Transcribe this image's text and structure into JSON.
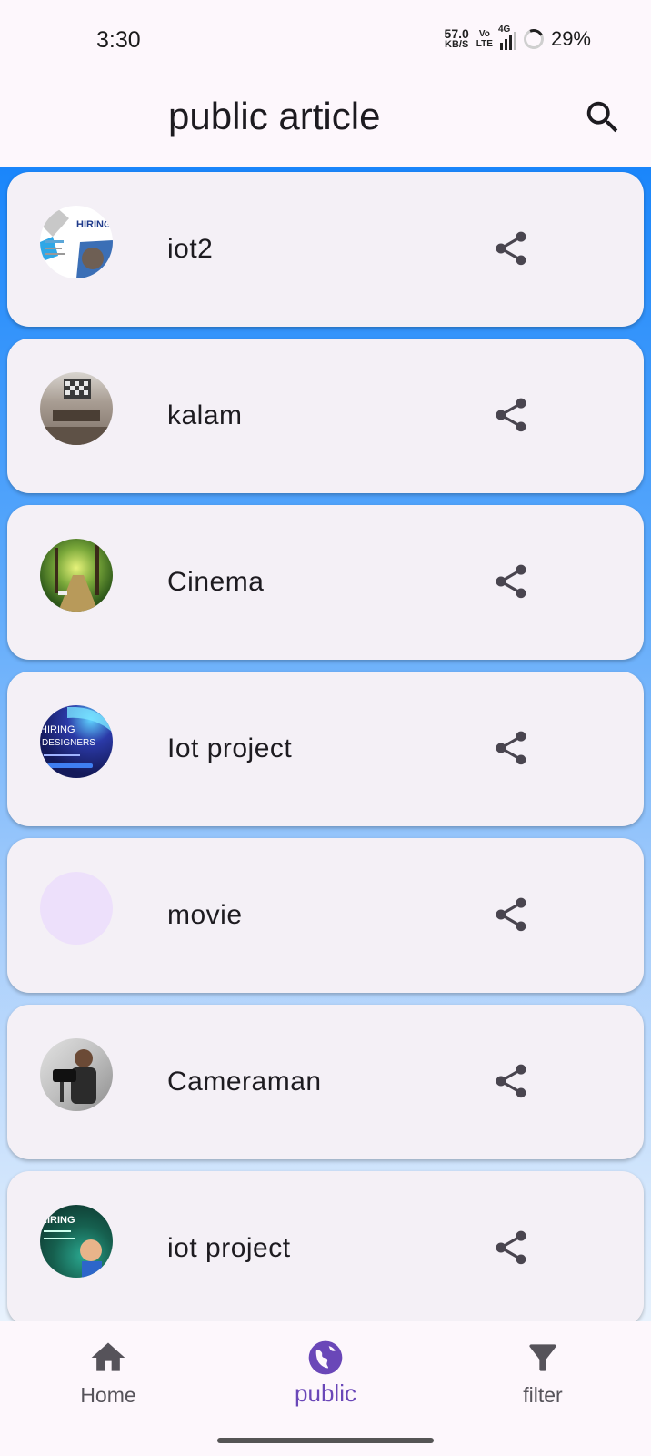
{
  "status_bar": {
    "time": "3:30",
    "net_speed_value": "57.0",
    "net_speed_unit": "KB/S",
    "volte_top": "Vo",
    "volte_bottom": "LTE",
    "network_type": "4G",
    "battery": "29%"
  },
  "app_bar": {
    "title": "public article",
    "search_icon": "search-icon"
  },
  "articles": [
    {
      "title": "iot2",
      "avatar": "hiring-poster-thumbnail",
      "share_icon": "share-icon"
    },
    {
      "title": "kalam",
      "avatar": "ceiling-room-photo",
      "share_icon": "share-icon"
    },
    {
      "title": "Cinema",
      "avatar": "forest-path-photo",
      "share_icon": "share-icon"
    },
    {
      "title": "Iot project",
      "avatar": "hiring-designers-poster",
      "share_icon": "share-icon"
    },
    {
      "title": "movie",
      "avatar": "empty-avatar-placeholder",
      "share_icon": "share-icon"
    },
    {
      "title": "Cameraman",
      "avatar": "cameraman-photo",
      "share_icon": "share-icon"
    },
    {
      "title": "iot project",
      "avatar": "hiring-poster-teal",
      "share_icon": "share-icon"
    }
  ],
  "avatar_text": {
    "iot2": "HIRING",
    "iot_project_line1": "HIRING",
    "iot_project_line2": "DESIGNERS",
    "iot_project2": "HIRING"
  },
  "bottom_nav": {
    "items": [
      {
        "label": "Home",
        "icon": "home-icon",
        "active": false
      },
      {
        "label": "public",
        "icon": "globe-icon",
        "active": true
      },
      {
        "label": "filter",
        "icon": "filter-icon",
        "active": false
      }
    ]
  },
  "colors": {
    "accent": "#6a47b8",
    "gradient_top": "#1a86fb",
    "card_bg": "#f4f0f6",
    "page_bg": "#fdf7fc"
  }
}
